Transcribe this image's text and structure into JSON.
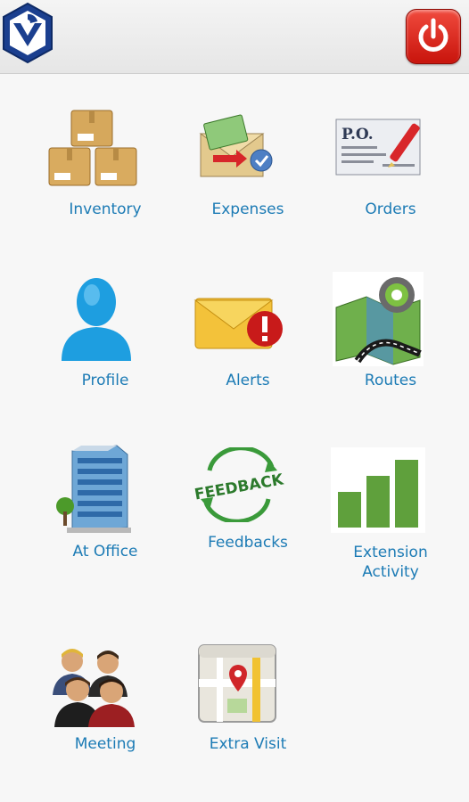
{
  "header": {
    "logo_icon": "app-logo-icon",
    "power_icon": "power-icon",
    "power_color": "#e0261a"
  },
  "menu": {
    "inventory_label": "Inventory",
    "expenses_label": "Expenses",
    "orders_label": "Orders",
    "po_text": "P.O.",
    "profile_label": "Profile",
    "alerts_label": "Alerts",
    "routes_label": "Routes",
    "at_office_label": "At Office",
    "feedbacks_label": "Feedbacks",
    "feedback_text": "FEEDBACK",
    "extension_label_line1": "Extension",
    "extension_label_line2": "Activity",
    "meeting_label": "Meeting",
    "extra_visit_label": "Extra Visit"
  },
  "colors": {
    "label": "#1c7bb5",
    "bar": "#5fa03c"
  }
}
